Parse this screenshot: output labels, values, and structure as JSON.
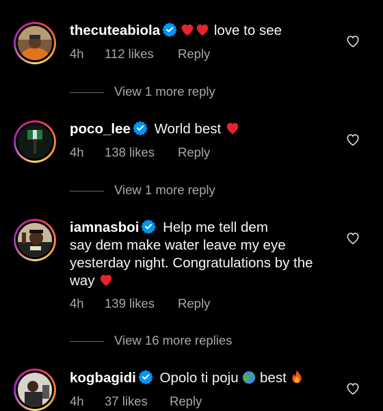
{
  "comments": [
    {
      "username": "thecuteabiola",
      "emojis": [
        "❤️",
        "❤️"
      ],
      "text": "love to see",
      "time": "4h",
      "likes": "112 likes",
      "reply": "Reply",
      "more_replies": "View 1 more reply"
    },
    {
      "username": "poco_lee",
      "text": "World best",
      "emojis_after": [
        "❤️"
      ],
      "time": "4h",
      "likes": "138 likes",
      "reply": "Reply",
      "more_replies": "View 1 more reply"
    },
    {
      "username": "iamnasboi",
      "text_lines": [
        "Help me tell dem",
        "say dem make water leave my eye",
        "yesterday night. Congratulations by the",
        "way"
      ],
      "emojis_after": [
        "❤️"
      ],
      "time": "4h",
      "likes": "139 likes",
      "reply": "Reply",
      "more_replies": "View 16 more replies"
    },
    {
      "username": "kogbagidi",
      "text": "Opolo ti poju",
      "emoji_mid": "🌎",
      "text_after": "best",
      "emoji_end": "🔥",
      "time": "4h",
      "likes": "37 likes",
      "reply": "Reply"
    }
  ],
  "colors": {
    "background": "#000000",
    "primary_text": "#f5f5f5",
    "secondary_text": "#a8a8a8",
    "verified": "#0095f6",
    "heart": "#ed4956"
  },
  "icons": {
    "verified": "verified-badge-icon",
    "like": "heart-outline-icon",
    "heart_emoji": "red-heart-emoji"
  }
}
